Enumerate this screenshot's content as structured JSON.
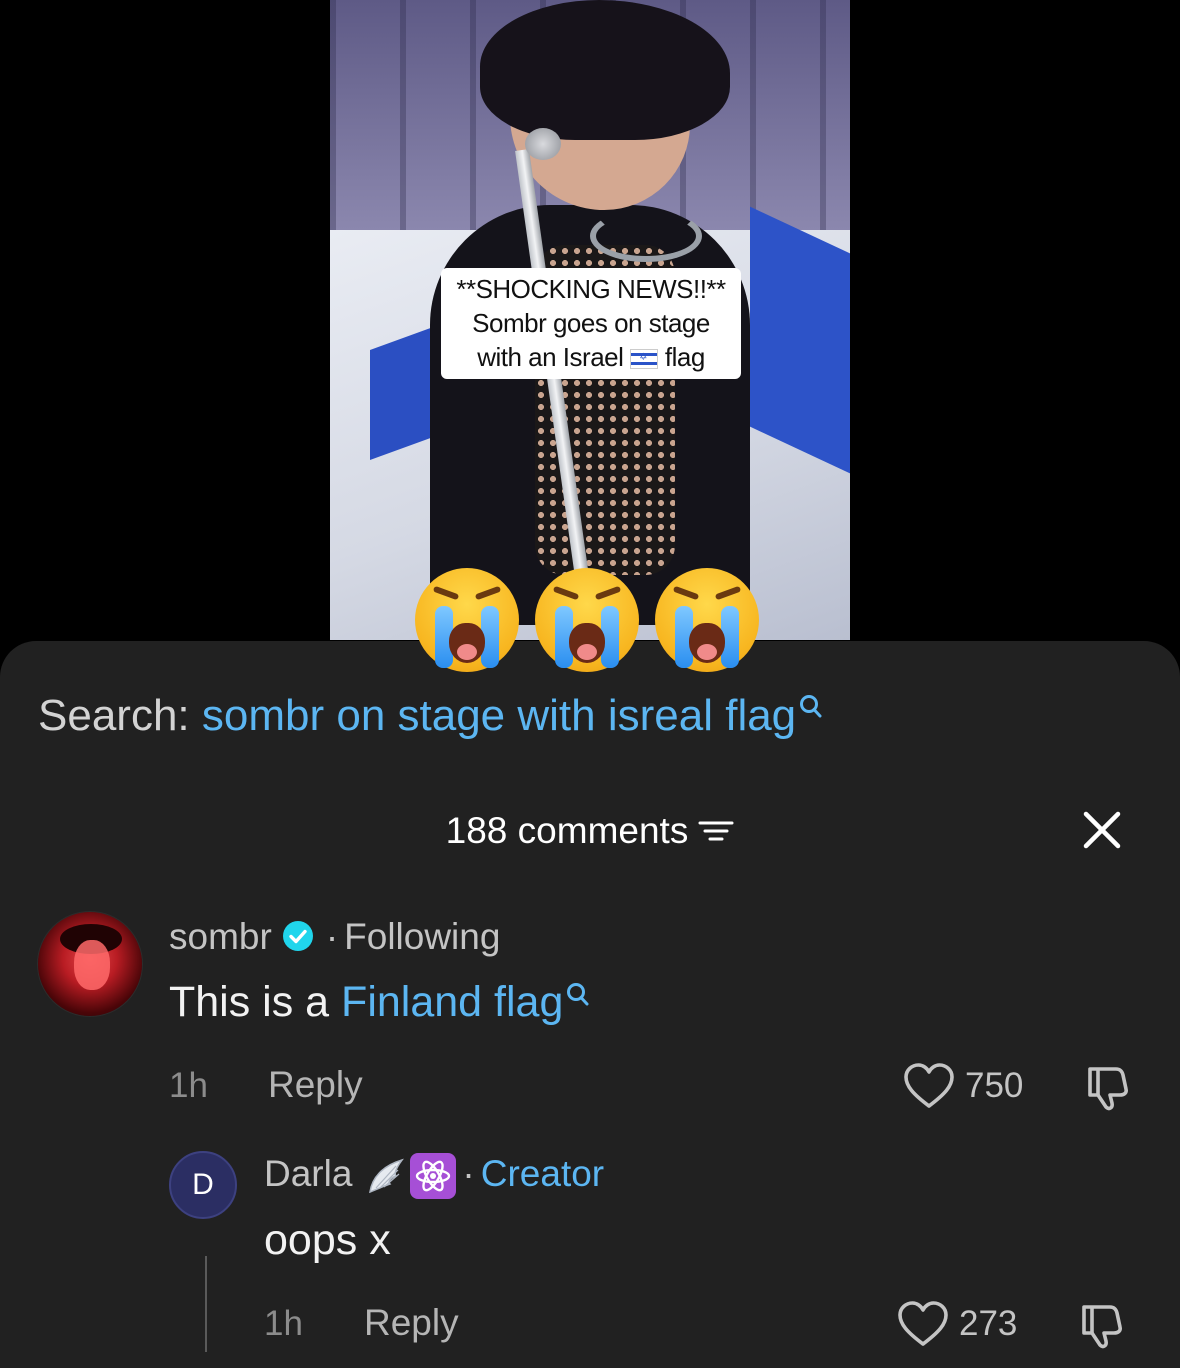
{
  "video": {
    "caption": {
      "line1": "**SHOCKING NEWS!!**",
      "line2": "Sombr goes on stage",
      "line3_before_flag": "with an Israel",
      "line3_after_flag": "flag"
    },
    "emojis": [
      "loudly-crying-face",
      "loudly-crying-face",
      "loudly-crying-face"
    ]
  },
  "search": {
    "prefix": "Search:",
    "query": "sombr on stage with isreal flag"
  },
  "comments_header": {
    "count_label": "188 comments"
  },
  "comments": [
    {
      "author": "sombr",
      "verified": true,
      "relation": "Following",
      "text_before_link": "This is a ",
      "link_text": "Finland flag",
      "time": "1h",
      "reply_label": "Reply",
      "likes": "750"
    }
  ],
  "replies": [
    {
      "avatar_letter": "D",
      "author": "Darla",
      "badge_icons": [
        "angel-wing-icon",
        "atom-symbol-icon"
      ],
      "role": "Creator",
      "text": "oops x",
      "time": "1h",
      "reply_label": "Reply",
      "likes": "273"
    }
  ],
  "colors": {
    "sheet_bg": "#212121",
    "link_blue": "#5cb6f2",
    "muted_text": "#8c8c8c",
    "verified_badge": "#20d5ec"
  }
}
